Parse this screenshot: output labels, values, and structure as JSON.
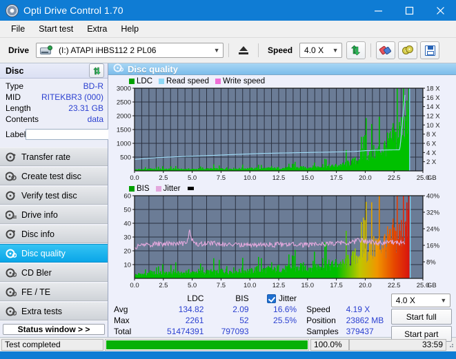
{
  "window": {
    "title": "Opti Drive Control 1.70",
    "icon": "disc-icon",
    "minimize": "—",
    "maximize": "□",
    "close": "✕"
  },
  "menu": {
    "items": [
      "File",
      "Start test",
      "Extra",
      "Help"
    ]
  },
  "toolbar": {
    "drive_label": "Drive",
    "drive_value": "(I:)   ATAPI iHBS112  2 PL06",
    "eject_icon": "eject-icon",
    "speed_label": "Speed",
    "speed_value": "4.0 X",
    "refresh_icon": "refresh-icon",
    "erase_icon": "eraser-icon",
    "disc_icon": "disc-tools-icon",
    "save_icon": "save-icon"
  },
  "disc_panel": {
    "header": "Disc",
    "refresh_icon": "refresh-arrows-icon",
    "rows": [
      {
        "key": "Type",
        "value": "BD-R"
      },
      {
        "key": "MID",
        "value": "RITEKBR3 (000)"
      },
      {
        "key": "Length",
        "value": "23.31 GB"
      },
      {
        "key": "Contents",
        "value": "data"
      }
    ],
    "label_key": "Label",
    "label_value": "",
    "label_placeholder": "",
    "disc_button_icon": "disc-icon"
  },
  "sidebar": {
    "items": [
      {
        "label": "Transfer rate",
        "icon": "disc-speed-icon",
        "selected": false
      },
      {
        "label": "Create test disc",
        "icon": "disc-create-icon",
        "selected": false
      },
      {
        "label": "Verify test disc",
        "icon": "disc-verify-icon",
        "selected": false
      },
      {
        "label": "Drive info",
        "icon": "drive-info-icon",
        "selected": false
      },
      {
        "label": "Disc info",
        "icon": "disc-info-icon",
        "selected": false
      },
      {
        "label": "Disc quality",
        "icon": "disc-quality-icon",
        "selected": true
      },
      {
        "label": "CD Bler",
        "icon": "cd-bler-icon",
        "selected": false
      },
      {
        "label": "FE / TE",
        "icon": "fe-te-icon",
        "selected": false
      },
      {
        "label": "Extra tests",
        "icon": "extra-tests-icon",
        "selected": false
      }
    ],
    "status_window_button": "Status window > >"
  },
  "panel": {
    "title": "Disc quality",
    "icon": "disc-quality-icon"
  },
  "stats": {
    "col_ldc": "LDC",
    "col_bis": "BIS",
    "rows": [
      {
        "name": "Avg",
        "ldc": "134.82",
        "bis": "2.09"
      },
      {
        "name": "Max",
        "ldc": "2261",
        "bis": "52"
      },
      {
        "name": "Total",
        "ldc": "51474391",
        "bis": "797093"
      }
    ],
    "jitter_label": "Jitter",
    "jitter_checked": true,
    "jitter_avg": "16.6%",
    "jitter_max": "25.5%",
    "speed_label": "Speed",
    "speed_value": "4.19 X",
    "position_label": "Position",
    "position_value": "23862 MB",
    "samples_label": "Samples",
    "samples_value": "379437",
    "speed_select": "4.0 X",
    "start_full": "Start full",
    "start_part": "Start part"
  },
  "statusbar": {
    "message": "Test completed",
    "progress_percent": "100.0%",
    "progress_value": 100,
    "elapsed": "33:59"
  },
  "colors": {
    "accent": "#0f7cd4",
    "ldc_green": "#00c000",
    "read_speed": "#8fd8f5",
    "write_speed": "#f06ed6",
    "bis_green": "#00a800",
    "jitter_pink": "#e3a8dd",
    "plot_bg": "#6b7c96",
    "progress_green": "#06b006",
    "link_blue": "#2a3fd0"
  },
  "chart_data": [
    {
      "type": "area",
      "id": "disc-quality-ldc",
      "title": "",
      "legend": [
        {
          "name": "LDC",
          "color": "#00a000"
        },
        {
          "name": "Read speed",
          "color": "#8fd8f5"
        },
        {
          "name": "Write speed",
          "color": "#f06ed6"
        }
      ],
      "legend_position": "top-left",
      "grid": true,
      "xlabel": "GB",
      "x_ticks": [
        "0.0",
        "2.5",
        "5.0",
        "7.5",
        "10.0",
        "12.5",
        "15.0",
        "17.5",
        "20.0",
        "22.5",
        "25.0"
      ],
      "xlim": [
        0,
        25
      ],
      "ylabel_left": "LDC",
      "y_ticks_left": [
        500,
        1000,
        1500,
        2000,
        2500,
        3000
      ],
      "ylim_left": [
        0,
        3000
      ],
      "ylabel_right": "Speed",
      "y_ticks_right": [
        "2 X",
        "4 X",
        "6 X",
        "8 X",
        "10 X",
        "12 X",
        "14 X",
        "16 X",
        "18 X"
      ],
      "ylim_right": [
        0,
        18
      ],
      "series": [
        {
          "name": "LDC",
          "color": "#00c000",
          "x": [
            0.0,
            0.5,
            1.0,
            1.5,
            2.0,
            2.5,
            3.0,
            3.5,
            4.0,
            4.5,
            5.0,
            5.5,
            6.0,
            6.5,
            7.0,
            7.5,
            8.0,
            8.5,
            9.0,
            9.5,
            10.0,
            10.5,
            11.0,
            11.5,
            12.0,
            12.5,
            13.0,
            13.5,
            14.0,
            14.5,
            15.0,
            15.5,
            16.0,
            16.5,
            17.0,
            17.5,
            18.0,
            18.5,
            19.0,
            19.3,
            19.6,
            19.9,
            20.1,
            20.3,
            20.6,
            20.9,
            21.2,
            21.5,
            21.8,
            22.0,
            22.2,
            22.4,
            22.6,
            22.8,
            23.0,
            23.2,
            23.4,
            23.6,
            23.8
          ],
          "values": [
            60,
            70,
            65,
            75,
            70,
            80,
            70,
            75,
            70,
            80,
            75,
            85,
            80,
            90,
            85,
            95,
            90,
            100,
            95,
            105,
            100,
            110,
            105,
            115,
            110,
            125,
            120,
            135,
            130,
            150,
            145,
            170,
            165,
            200,
            195,
            240,
            260,
            330,
            420,
            470,
            700,
            660,
            740,
            700,
            780,
            820,
            900,
            1000,
            1100,
            1250,
            1300,
            1500,
            1400,
            1650,
            1750,
            1900,
            2050,
            2200,
            2261
          ]
        },
        {
          "name": "Read speed",
          "color": "#8fd8f5",
          "x": [
            0.0,
            1.0,
            2.0,
            3.0,
            4.0,
            5.0,
            6.0,
            7.0,
            8.0,
            9.0,
            10.0,
            11.0,
            12.0,
            13.0,
            14.0,
            15.0,
            16.0,
            17.0,
            18.0,
            19.0,
            20.0,
            21.0,
            22.0,
            23.0,
            23.5
          ],
          "values": [
            2.5,
            2.7,
            2.9,
            3.0,
            3.1,
            3.2,
            3.3,
            3.4,
            3.5,
            3.6,
            3.7,
            3.8,
            3.85,
            3.9,
            3.95,
            4.0,
            4.05,
            4.1,
            4.15,
            4.2,
            4.4,
            4.5,
            4.55,
            4.6,
            18.0
          ]
        }
      ]
    },
    {
      "type": "area",
      "id": "disc-quality-bis",
      "title": "",
      "legend": [
        {
          "name": "BIS",
          "color": "#00a000"
        },
        {
          "name": "Jitter",
          "color": "#e3a8dd"
        }
      ],
      "legend_position": "top-left",
      "grid": true,
      "xlabel": "GB",
      "x_ticks": [
        "0.0",
        "2.5",
        "5.0",
        "7.5",
        "10.0",
        "12.5",
        "15.0",
        "17.5",
        "20.0",
        "22.5",
        "25.0"
      ],
      "xlim": [
        0,
        25
      ],
      "ylabel_left": "BIS",
      "y_ticks_left": [
        10,
        20,
        30,
        40,
        50,
        60
      ],
      "ylim_left": [
        0,
        60
      ],
      "ylabel_right": "Jitter",
      "y_ticks_right": [
        "8%",
        "16%",
        "24%",
        "32%",
        "40%"
      ],
      "ylim_right": [
        0,
        40
      ],
      "series": [
        {
          "name": "BIS",
          "color": "gradient-green-to-red",
          "x": [
            0.0,
            0.5,
            1.0,
            1.5,
            2.0,
            2.5,
            3.0,
            3.5,
            4.0,
            4.5,
            5.0,
            5.5,
            6.0,
            6.5,
            7.0,
            7.5,
            8.0,
            8.5,
            9.0,
            9.5,
            10.0,
            10.5,
            11.0,
            11.5,
            12.0,
            12.5,
            13.0,
            13.5,
            14.0,
            14.5,
            15.0,
            15.5,
            16.0,
            16.5,
            17.0,
            17.5,
            18.0,
            18.5,
            19.0,
            19.4,
            19.8,
            20.0,
            20.3,
            20.6,
            20.9,
            21.2,
            21.5,
            21.8,
            22.0,
            22.2,
            22.4,
            22.6,
            22.8,
            23.0,
            23.2,
            23.4,
            23.6,
            23.8
          ],
          "values": [
            3,
            4,
            3,
            5,
            4,
            5,
            4,
            5,
            4,
            6,
            5,
            6,
            5,
            6,
            5,
            7,
            6,
            7,
            6,
            7,
            6,
            8,
            7,
            8,
            7,
            9,
            8,
            9,
            8,
            10,
            9,
            11,
            10,
            12,
            11,
            13,
            12,
            15,
            18,
            22,
            24,
            20,
            26,
            24,
            30,
            28,
            32,
            30,
            34,
            31,
            38,
            34,
            40,
            36,
            44,
            42,
            48,
            52
          ]
        },
        {
          "name": "Jitter",
          "color": "#e3a8dd",
          "x": [
            0.0,
            0.5,
            1.0,
            1.5,
            2.0,
            2.5,
            3.0,
            3.5,
            4.0,
            4.5,
            4.8,
            5.0,
            5.3,
            5.8,
            6.5,
            7.0,
            7.5,
            8.0,
            8.5,
            9.0,
            9.5,
            10.0,
            10.5,
            11.0,
            11.5,
            12.0,
            12.5,
            13.0,
            13.5,
            14.0,
            14.5,
            15.0,
            15.5,
            16.0,
            16.5,
            17.0,
            17.5,
            18.0,
            18.5,
            19.0,
            19.5,
            20.0,
            20.5,
            21.0,
            21.5,
            22.0,
            22.5,
            23.0,
            23.5
          ],
          "values": [
            14.5,
            16.0,
            16.5,
            16.3,
            16.8,
            16.4,
            17.2,
            16.6,
            17.0,
            16.4,
            23.0,
            18.5,
            16.9,
            16.5,
            17.2,
            16.8,
            16.4,
            16.6,
            16.2,
            16.4,
            16.1,
            16.3,
            16.0,
            16.2,
            16.5,
            16.2,
            16.4,
            16.1,
            16.3,
            16.5,
            16.2,
            16.4,
            16.2,
            16.5,
            16.3,
            16.8,
            17.0,
            17.4,
            17.2,
            17.6,
            18.8,
            17.8,
            17.6,
            17.4,
            17.2,
            17.6,
            17.4,
            17.2,
            17.0
          ]
        }
      ]
    }
  ]
}
